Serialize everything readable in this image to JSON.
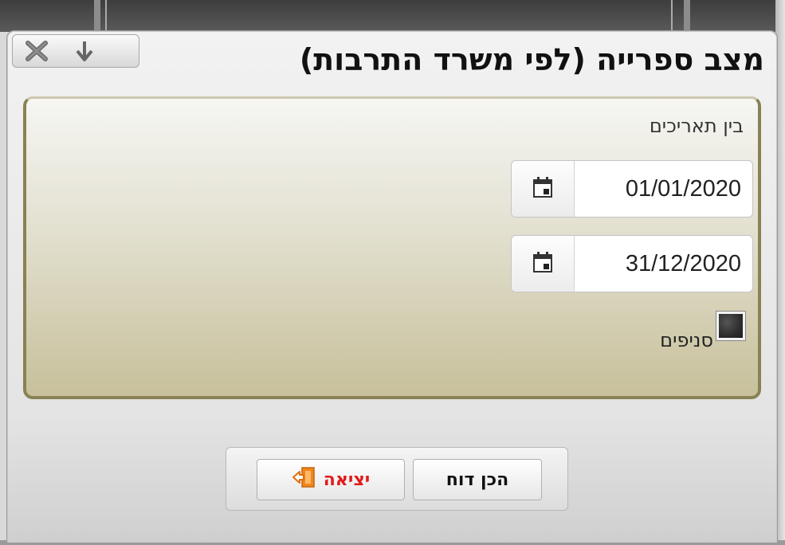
{
  "dialog": {
    "title": "מצב ספרייה (לפי משרד התרבות)",
    "controls": {
      "pin_icon": "arrow-down-icon",
      "close_icon": "close-icon"
    }
  },
  "panel": {
    "range_label": "בין תאריכים",
    "from_date": "01/01/2020",
    "to_date": "31/12/2020",
    "calendar_icon": "calendar-icon",
    "branches_label": "סניפים",
    "branches_checked": false
  },
  "buttons": {
    "report_label": "הכן דוח",
    "exit_label": "יציאה",
    "exit_icon": "exit-door-icon"
  },
  "colors": {
    "panel_border": "#8a8154",
    "exit_text": "#e11b1b",
    "exit_icon": "#f0871e"
  }
}
